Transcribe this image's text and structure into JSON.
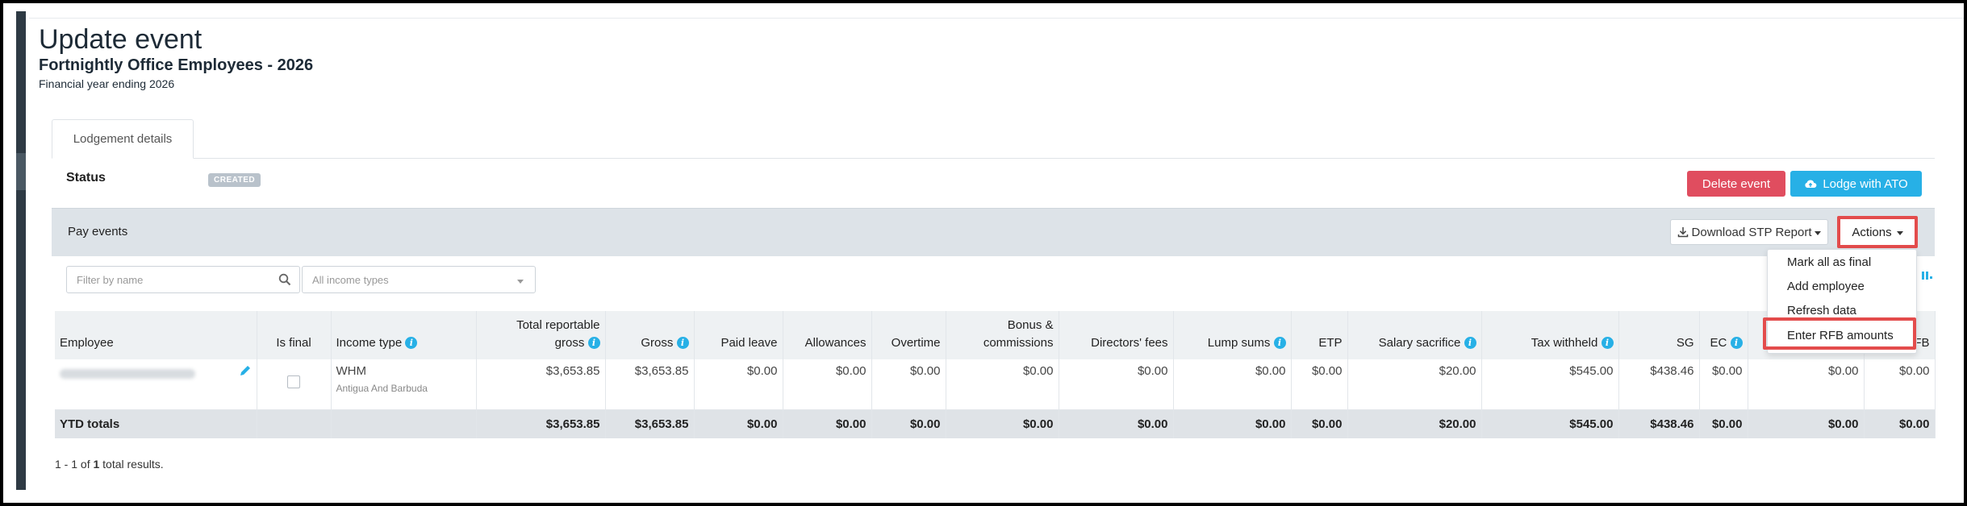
{
  "header": {
    "title": "Update event",
    "subtitle": "Fortnightly Office Employees - 2026",
    "financial_year": "Financial year ending 2026"
  },
  "tabs": [
    {
      "label": "Lodgement details"
    }
  ],
  "status": {
    "label": "Status",
    "badge": "CREATED"
  },
  "buttons": {
    "delete": "Delete event",
    "lodge": "Lodge with ATO"
  },
  "pay_events": {
    "title": "Pay events",
    "download_label": "Download STP Report",
    "actions_label": "Actions",
    "actions_menu": [
      "Mark all as final",
      "Add employee",
      "Refresh data",
      "Enter RFB amounts"
    ]
  },
  "filters": {
    "name_placeholder": "Filter by name",
    "income_type": "All income types"
  },
  "table": {
    "headers": {
      "employee": "Employee",
      "is_final": "Is final",
      "income_type": "Income type",
      "total_reportable_gross_1": "Total reportable",
      "total_reportable_gross_2": "gross",
      "gross": "Gross",
      "paid_leave": "Paid leave",
      "allowances": "Allowances",
      "overtime": "Overtime",
      "bonus_1": "Bonus &",
      "bonus_2": "commissions",
      "directors_fees": "Directors' fees",
      "lump_sums": "Lump sums",
      "etp": "ETP",
      "salary_sacrifice": "Salary sacrifice",
      "tax_withheld": "Tax withheld",
      "sg": "SG",
      "ec": "EC",
      "rfb": "FB"
    },
    "row": {
      "income_type": "WHM",
      "country": "Antigua And Barbuda",
      "total_reportable_gross": "$3,653.85",
      "gross": "$3,653.85",
      "paid_leave": "$0.00",
      "allowances": "$0.00",
      "overtime": "$0.00",
      "bonus": "$0.00",
      "directors_fees": "$0.00",
      "lump_sums": "$0.00",
      "etp": "$0.00",
      "salary_sacrifice": "$20.00",
      "tax_withheld": "$545.00",
      "sg": "$438.46",
      "ec": "$0.00",
      "col_hidden": "$0.00",
      "rfb": "$0.00"
    },
    "ytd": {
      "label": "YTD totals",
      "total_reportable_gross": "$3,653.85",
      "gross": "$3,653.85",
      "paid_leave": "$0.00",
      "allowances": "$0.00",
      "overtime": "$0.00",
      "bonus": "$0.00",
      "directors_fees": "$0.00",
      "lump_sums": "$0.00",
      "etp": "$0.00",
      "salary_sacrifice": "$20.00",
      "tax_withheld": "$545.00",
      "sg": "$438.46",
      "ec": "$0.00",
      "col_hidden": "$0.00",
      "rfb": "$0.00"
    }
  },
  "pagination": {
    "range": "1 - 1 of ",
    "count": "1",
    "suffix": " total results."
  },
  "colors": {
    "danger": "#e04d5f",
    "primary": "#27b0e6",
    "highlight": "#e34c4c"
  }
}
